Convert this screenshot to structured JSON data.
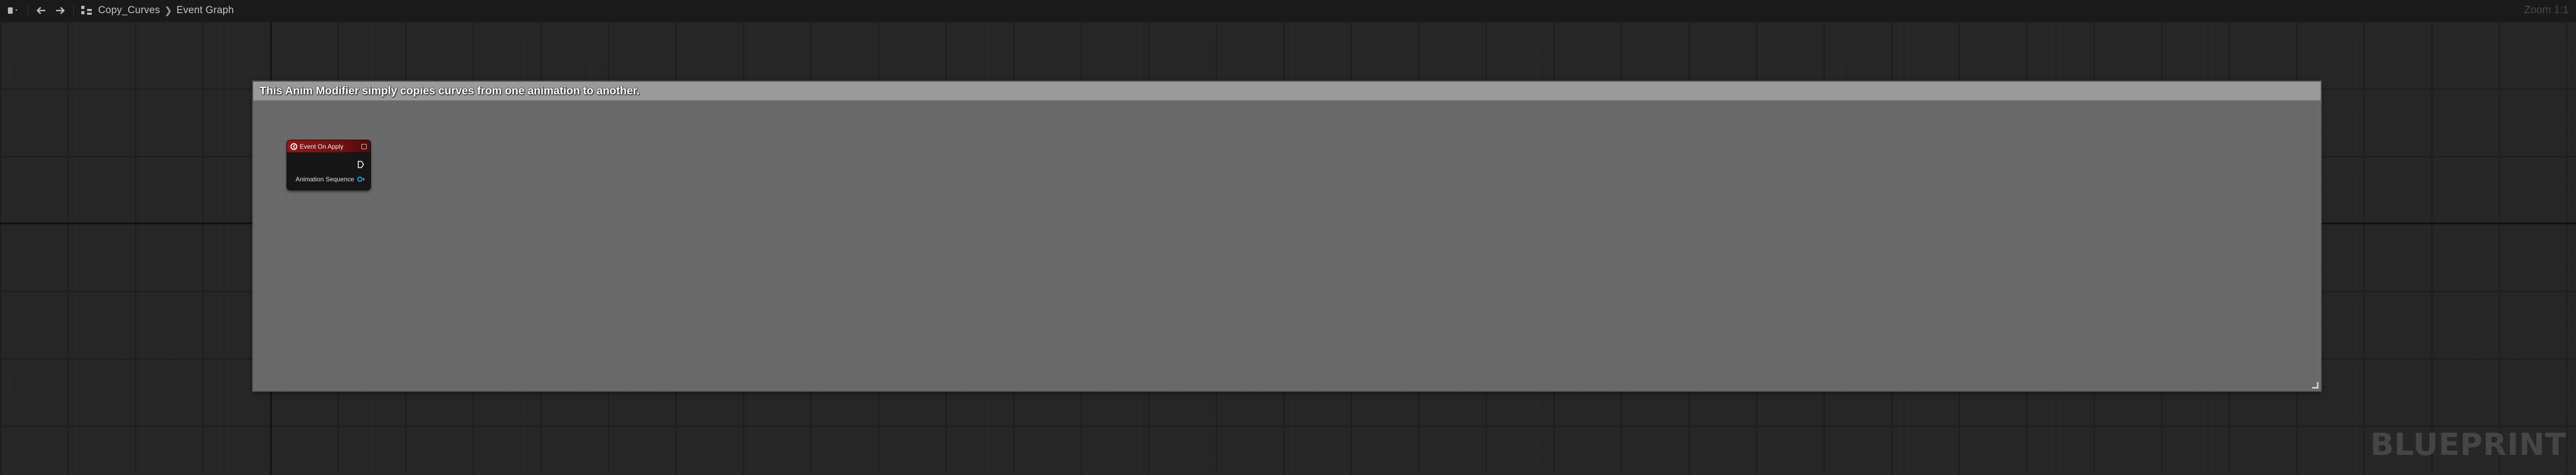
{
  "toolbar": {
    "blueprint_menu_icon": "blueprint-icon",
    "back_icon": "arrow-left-icon",
    "forward_icon": "arrow-right-icon",
    "hierarchy_icon": "graph-hierarchy-icon"
  },
  "breadcrumb": {
    "items": [
      "Copy_Curves",
      "Event Graph"
    ],
    "separator_icon": "chevron-right-icon"
  },
  "zoom": {
    "label": "Zoom 1:1"
  },
  "comment": {
    "title": "This Anim Modifier simply copies curves from one animation to another."
  },
  "event_node": {
    "title": "Event On Apply",
    "header_color": "#8e1818",
    "output_pins": [
      {
        "label": "",
        "type": "exec"
      },
      {
        "label": "Animation Sequence",
        "type": "object",
        "color": "#2fa6d6"
      }
    ]
  },
  "watermark": {
    "text": "BLUEPRINT"
  }
}
